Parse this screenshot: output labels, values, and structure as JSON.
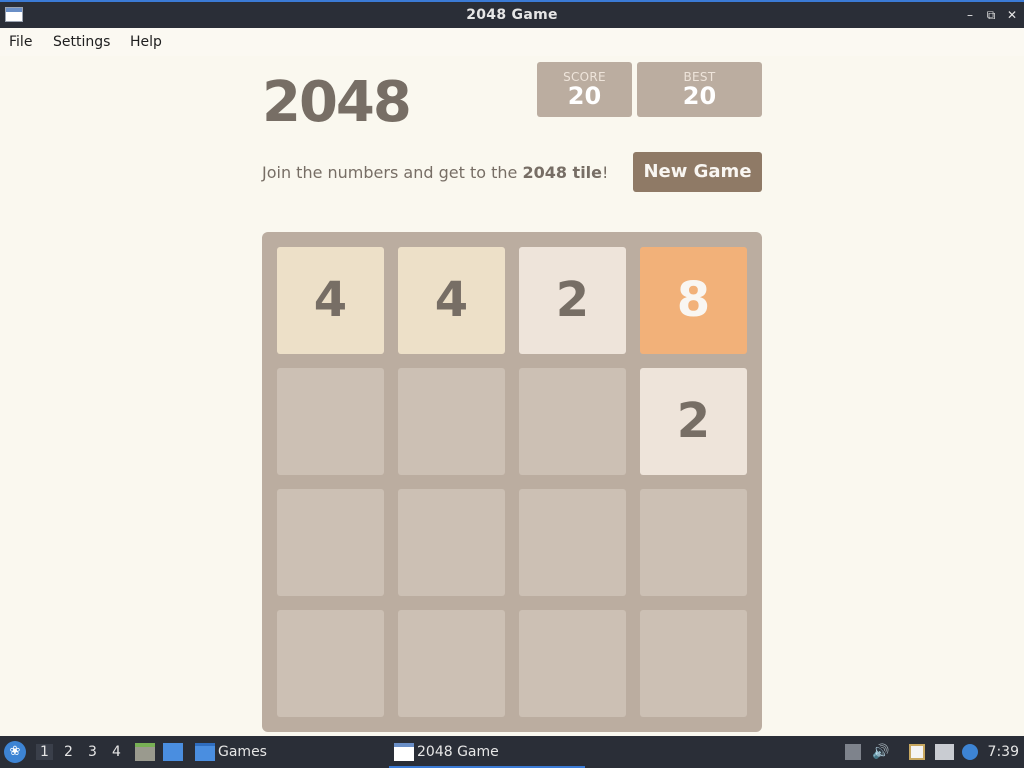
{
  "window": {
    "title": "2048 Game"
  },
  "menu": {
    "items": [
      "File",
      "Settings",
      "Help"
    ]
  },
  "game": {
    "heading": "2048",
    "score": {
      "label": "SCORE",
      "value": "20"
    },
    "best": {
      "label": "BEST",
      "value": "20"
    },
    "intro_prefix": "Join the numbers and get to the ",
    "intro_bold": "2048 tile",
    "intro_suffix": "!",
    "new_game_label": "New Game",
    "tiles": [
      [
        "4",
        "4",
        "2",
        "8"
      ],
      [
        "",
        "",
        "",
        "2"
      ],
      [
        "",
        "",
        "",
        ""
      ],
      [
        "",
        "",
        "",
        ""
      ]
    ]
  },
  "taskbar": {
    "workspaces": [
      "1",
      "2",
      "3",
      "4"
    ],
    "active_workspace": "1",
    "tasks": {
      "games": "Games",
      "game_window": "2048 Game"
    },
    "clock": "7:39"
  },
  "colors": {
    "background": "#faf8ef",
    "board": "#bbada0",
    "tile_2": "#eee4da",
    "tile_4": "#ede0c8",
    "tile_8": "#f2b179",
    "button": "#8f7a66",
    "text": "#776e65"
  }
}
